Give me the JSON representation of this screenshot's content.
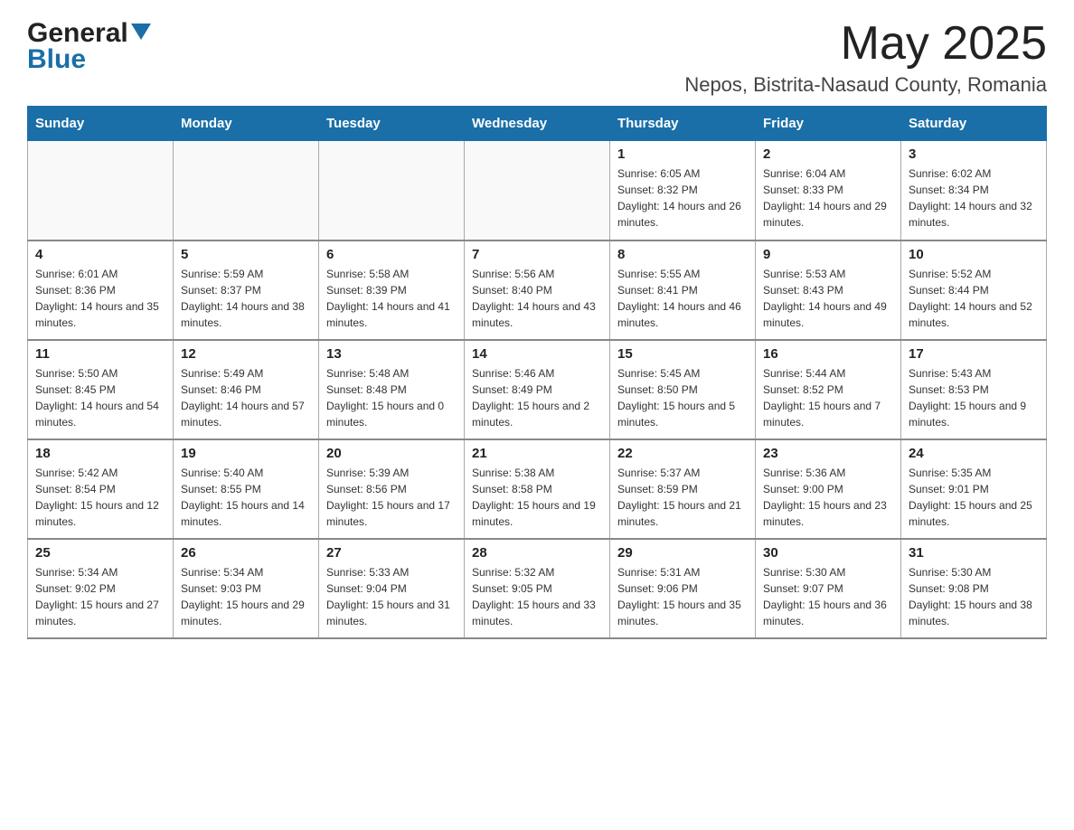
{
  "header": {
    "month_year": "May 2025",
    "location": "Nepos, Bistrita-Nasaud County, Romania",
    "logo_line1": "General",
    "logo_line2": "Blue"
  },
  "days_of_week": [
    "Sunday",
    "Monday",
    "Tuesday",
    "Wednesday",
    "Thursday",
    "Friday",
    "Saturday"
  ],
  "weeks": [
    [
      {
        "day": "",
        "info": ""
      },
      {
        "day": "",
        "info": ""
      },
      {
        "day": "",
        "info": ""
      },
      {
        "day": "",
        "info": ""
      },
      {
        "day": "1",
        "info": "Sunrise: 6:05 AM\nSunset: 8:32 PM\nDaylight: 14 hours and 26 minutes."
      },
      {
        "day": "2",
        "info": "Sunrise: 6:04 AM\nSunset: 8:33 PM\nDaylight: 14 hours and 29 minutes."
      },
      {
        "day": "3",
        "info": "Sunrise: 6:02 AM\nSunset: 8:34 PM\nDaylight: 14 hours and 32 minutes."
      }
    ],
    [
      {
        "day": "4",
        "info": "Sunrise: 6:01 AM\nSunset: 8:36 PM\nDaylight: 14 hours and 35 minutes."
      },
      {
        "day": "5",
        "info": "Sunrise: 5:59 AM\nSunset: 8:37 PM\nDaylight: 14 hours and 38 minutes."
      },
      {
        "day": "6",
        "info": "Sunrise: 5:58 AM\nSunset: 8:39 PM\nDaylight: 14 hours and 41 minutes."
      },
      {
        "day": "7",
        "info": "Sunrise: 5:56 AM\nSunset: 8:40 PM\nDaylight: 14 hours and 43 minutes."
      },
      {
        "day": "8",
        "info": "Sunrise: 5:55 AM\nSunset: 8:41 PM\nDaylight: 14 hours and 46 minutes."
      },
      {
        "day": "9",
        "info": "Sunrise: 5:53 AM\nSunset: 8:43 PM\nDaylight: 14 hours and 49 minutes."
      },
      {
        "day": "10",
        "info": "Sunrise: 5:52 AM\nSunset: 8:44 PM\nDaylight: 14 hours and 52 minutes."
      }
    ],
    [
      {
        "day": "11",
        "info": "Sunrise: 5:50 AM\nSunset: 8:45 PM\nDaylight: 14 hours and 54 minutes."
      },
      {
        "day": "12",
        "info": "Sunrise: 5:49 AM\nSunset: 8:46 PM\nDaylight: 14 hours and 57 minutes."
      },
      {
        "day": "13",
        "info": "Sunrise: 5:48 AM\nSunset: 8:48 PM\nDaylight: 15 hours and 0 minutes."
      },
      {
        "day": "14",
        "info": "Sunrise: 5:46 AM\nSunset: 8:49 PM\nDaylight: 15 hours and 2 minutes."
      },
      {
        "day": "15",
        "info": "Sunrise: 5:45 AM\nSunset: 8:50 PM\nDaylight: 15 hours and 5 minutes."
      },
      {
        "day": "16",
        "info": "Sunrise: 5:44 AM\nSunset: 8:52 PM\nDaylight: 15 hours and 7 minutes."
      },
      {
        "day": "17",
        "info": "Sunrise: 5:43 AM\nSunset: 8:53 PM\nDaylight: 15 hours and 9 minutes."
      }
    ],
    [
      {
        "day": "18",
        "info": "Sunrise: 5:42 AM\nSunset: 8:54 PM\nDaylight: 15 hours and 12 minutes."
      },
      {
        "day": "19",
        "info": "Sunrise: 5:40 AM\nSunset: 8:55 PM\nDaylight: 15 hours and 14 minutes."
      },
      {
        "day": "20",
        "info": "Sunrise: 5:39 AM\nSunset: 8:56 PM\nDaylight: 15 hours and 17 minutes."
      },
      {
        "day": "21",
        "info": "Sunrise: 5:38 AM\nSunset: 8:58 PM\nDaylight: 15 hours and 19 minutes."
      },
      {
        "day": "22",
        "info": "Sunrise: 5:37 AM\nSunset: 8:59 PM\nDaylight: 15 hours and 21 minutes."
      },
      {
        "day": "23",
        "info": "Sunrise: 5:36 AM\nSunset: 9:00 PM\nDaylight: 15 hours and 23 minutes."
      },
      {
        "day": "24",
        "info": "Sunrise: 5:35 AM\nSunset: 9:01 PM\nDaylight: 15 hours and 25 minutes."
      }
    ],
    [
      {
        "day": "25",
        "info": "Sunrise: 5:34 AM\nSunset: 9:02 PM\nDaylight: 15 hours and 27 minutes."
      },
      {
        "day": "26",
        "info": "Sunrise: 5:34 AM\nSunset: 9:03 PM\nDaylight: 15 hours and 29 minutes."
      },
      {
        "day": "27",
        "info": "Sunrise: 5:33 AM\nSunset: 9:04 PM\nDaylight: 15 hours and 31 minutes."
      },
      {
        "day": "28",
        "info": "Sunrise: 5:32 AM\nSunset: 9:05 PM\nDaylight: 15 hours and 33 minutes."
      },
      {
        "day": "29",
        "info": "Sunrise: 5:31 AM\nSunset: 9:06 PM\nDaylight: 15 hours and 35 minutes."
      },
      {
        "day": "30",
        "info": "Sunrise: 5:30 AM\nSunset: 9:07 PM\nDaylight: 15 hours and 36 minutes."
      },
      {
        "day": "31",
        "info": "Sunrise: 5:30 AM\nSunset: 9:08 PM\nDaylight: 15 hours and 38 minutes."
      }
    ]
  ]
}
